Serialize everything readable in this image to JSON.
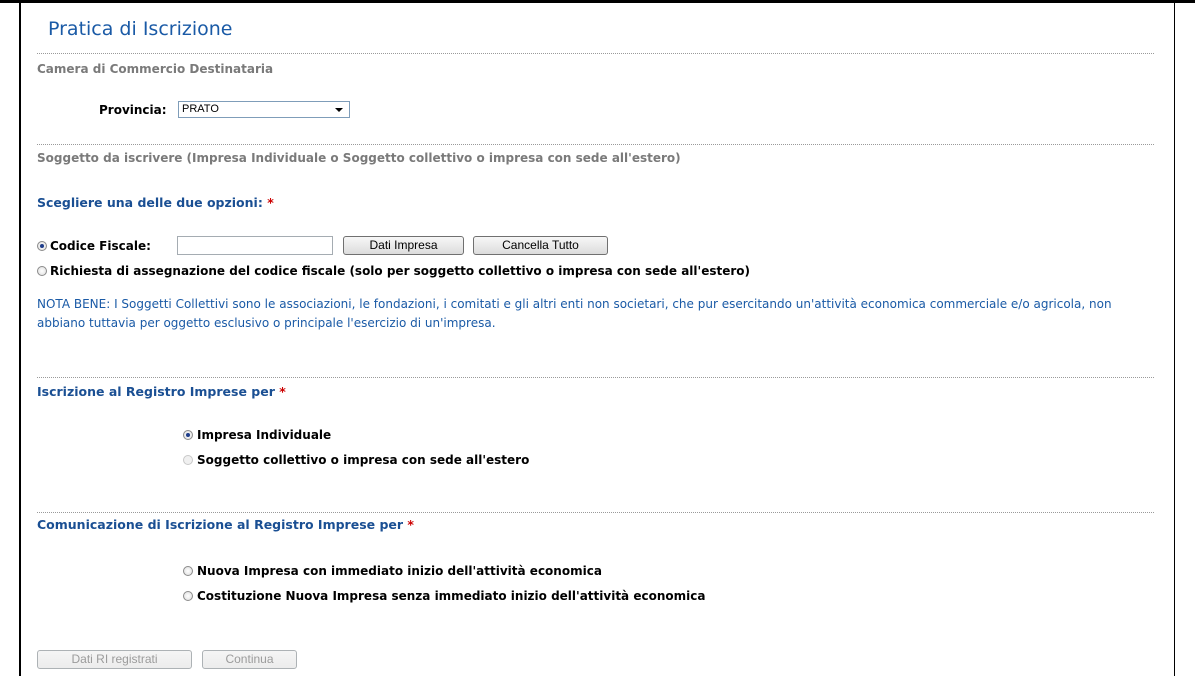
{
  "page": {
    "title": "Pratica di Iscrizione"
  },
  "camera": {
    "heading": "Camera di Commercio Destinataria",
    "provincia_label": "Provincia:",
    "provincia_value": "PRATO"
  },
  "soggetto": {
    "heading": "Soggetto da iscrivere (Impresa Individuale o Soggetto collettivo o impresa con sede all'estero)",
    "choose_label": "Scegliere una delle due opzioni:",
    "required_mark": "*",
    "codice_fiscale_label": "Codice Fiscale:",
    "codice_fiscale_value": "",
    "dati_impresa_button": "Dati Impresa",
    "cancella_tutto_button": "Cancella Tutto",
    "richiesta_label": "Richiesta di assegnazione del codice fiscale (solo per soggetto collettivo o impresa con sede all'estero)",
    "nota_bene": "NOTA BENE: I Soggetti Collettivi sono le associazioni, le fondazioni, i comitati e gli altri enti non societari, che pur esercitando un'attività economica commerciale e/o agricola, non abbiano tuttavia per oggetto esclusivo o principale l'esercizio di un'impresa."
  },
  "iscrizione": {
    "heading": "Iscrizione al Registro Imprese per",
    "required_mark": "*",
    "options": [
      "Impresa Individuale",
      "Soggetto collettivo o impresa con sede all'estero"
    ]
  },
  "comunicazione": {
    "heading": "Comunicazione di Iscrizione al Registro Imprese per",
    "required_mark": "*",
    "options": [
      "Nuova Impresa con immediato inizio dell'attività economica",
      "Costituzione Nuova Impresa senza immediato inizio dell'attività economica"
    ]
  },
  "footer": {
    "dati_ri_button": "Dati RI registrati",
    "continua_button": "Continua"
  }
}
